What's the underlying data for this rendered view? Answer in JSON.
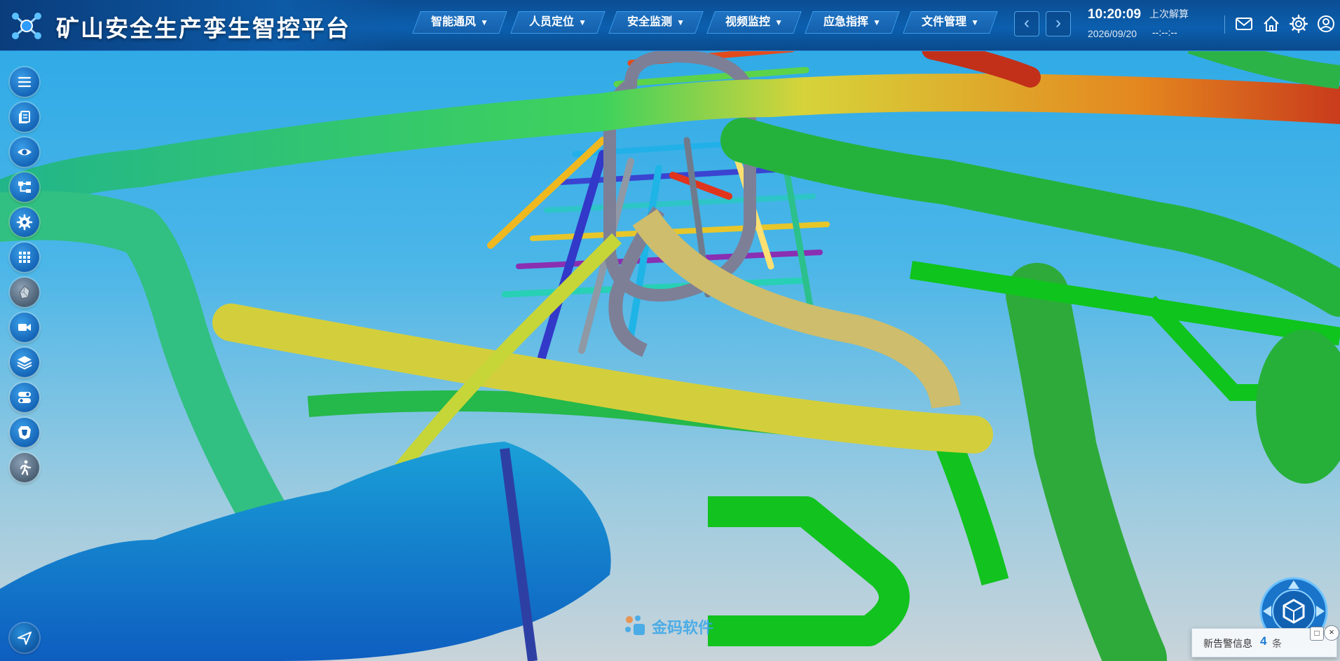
{
  "app": {
    "title": "矿山安全生产孪生智控平台"
  },
  "nav": {
    "items": [
      {
        "label": "智能通风"
      },
      {
        "label": "人员定位"
      },
      {
        "label": "安全监测"
      },
      {
        "label": "视频监控"
      },
      {
        "label": "应急指挥"
      },
      {
        "label": "文件管理"
      }
    ],
    "prev_glyph": "‹",
    "next_glyph": "›"
  },
  "status": {
    "time": "10:20:09",
    "date": "2026/09/20",
    "last_calc_label": "上次解算",
    "last_calc_value": "--:--:--"
  },
  "header_icons": [
    "mail-icon",
    "home-icon",
    "gear-icon",
    "user-icon"
  ],
  "left_toolbar": [
    "menu-icon",
    "documents-icon",
    "eye-icon",
    "tree-structure-icon",
    "settings-icon",
    "grid-icon",
    "ore-icon",
    "video-camera-icon",
    "layers-icon",
    "toggle-icon",
    "shield-icon",
    "escape-runner-icon",
    "navigate-arrow-icon"
  ],
  "watermark": {
    "text": "金码软件"
  },
  "alert": {
    "label": "新告警信息",
    "count": "4",
    "unit": "条"
  },
  "colors": {
    "header_bg": "#0b5fae",
    "accent": "#1c7ad6",
    "sky_top": "#2aa8e6",
    "sky_bottom": "#c9d4da"
  }
}
